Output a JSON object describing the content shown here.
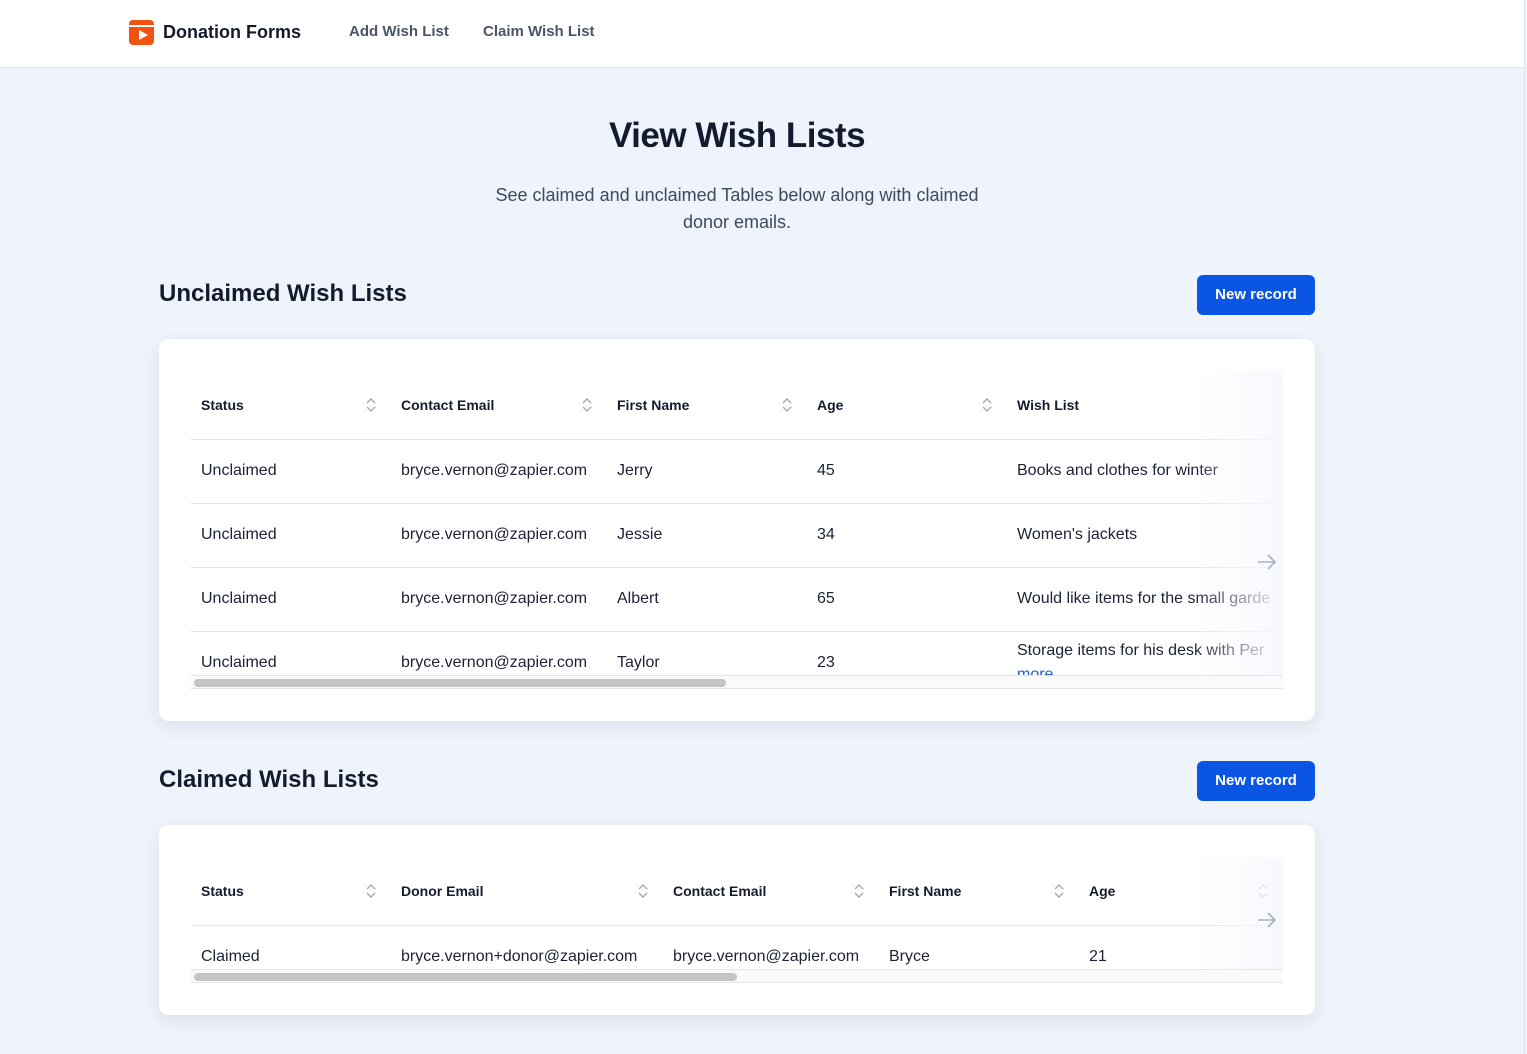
{
  "app": {
    "brand_name": "Donation Forms",
    "brand_color": "#f2520f",
    "nav": [
      "Add Wish List",
      "Claim Wish List"
    ]
  },
  "hero": {
    "title": "View Wish Lists",
    "subtitle_line1": "See claimed and unclaimed Tables below along with claimed",
    "subtitle_line2": "donor emails."
  },
  "unclaimed": {
    "title": "Unclaimed Wish Lists",
    "button_label": "New record",
    "columns": [
      "Status",
      "Contact Email",
      "First Name",
      "Age",
      "Wish List"
    ],
    "rows": [
      [
        "Unclaimed",
        "bryce.vernon@zapier.com",
        "Jerry",
        "45",
        "Books and clothes for winter"
      ],
      [
        "Unclaimed",
        "bryce.vernon@zapier.com",
        "Jessie",
        "34",
        "Women's jackets"
      ],
      [
        "Unclaimed",
        "bryce.vernon@zapier.com",
        "Albert",
        "65",
        "Would like items for the small garde"
      ],
      [
        "Unclaimed",
        "bryce.vernon@zapier.com",
        "Taylor",
        "23",
        "Storage items for his desk with Per"
      ]
    ],
    "more_label": "more",
    "scroll_fraction": 0.49
  },
  "claimed": {
    "title": "Claimed Wish Lists",
    "button_label": "New record",
    "columns": [
      "Status",
      "Donor Email",
      "Contact Email",
      "First Name",
      "Age"
    ],
    "rows": [
      [
        "Claimed",
        "bryce.vernon+donor@zapier.com",
        "bryce.vernon@zapier.com",
        "Bryce",
        "21"
      ]
    ],
    "scroll_fraction": 0.5
  },
  "colors": {
    "accent": "#0b55e5",
    "background": "#eff3fb"
  }
}
